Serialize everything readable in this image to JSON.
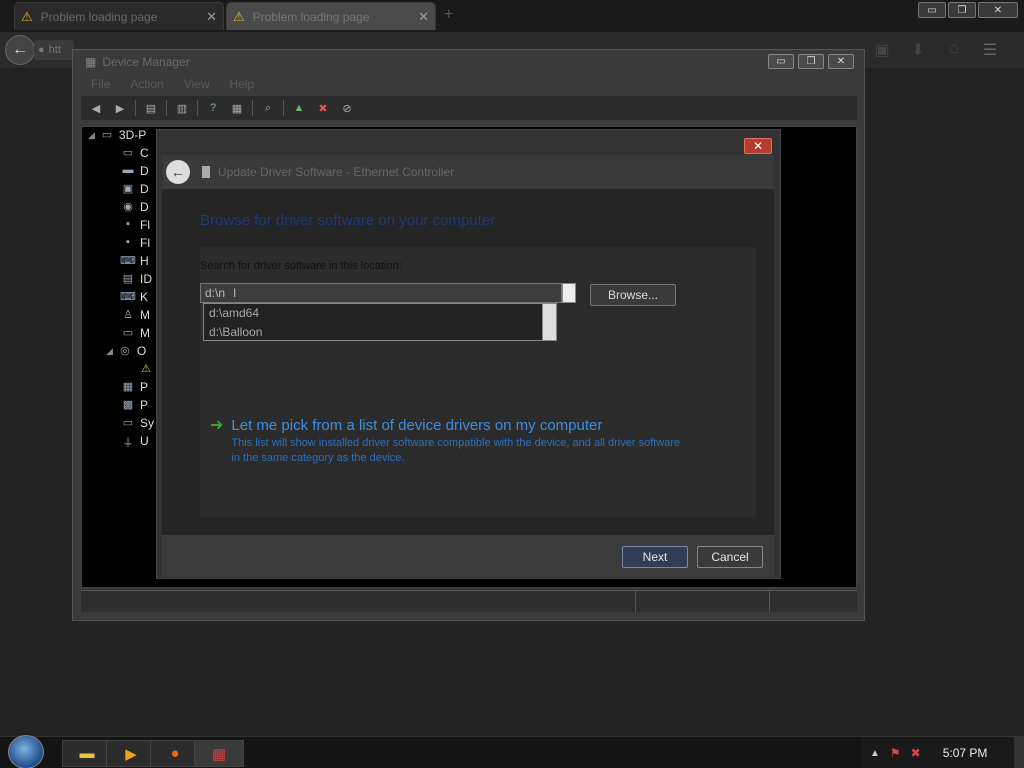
{
  "browser": {
    "tabs": [
      {
        "title": "Problem loading page",
        "icon": "warning-icon"
      },
      {
        "title": "Problem loading page",
        "icon": "warning-icon"
      }
    ],
    "new_tab": "+",
    "url_fragment": "htt",
    "win_buttons": {
      "minimize": "▭",
      "restore": "❐",
      "close": "✕"
    },
    "nav_icons": [
      "library-icon",
      "download-icon",
      "home-icon",
      "menu-icon"
    ]
  },
  "device_manager": {
    "title": "Device Manager",
    "menu": [
      "File",
      "Action",
      "View",
      "Help"
    ],
    "tree": [
      {
        "label": "3D-P",
        "icon": "computer-icon"
      },
      {
        "label": "C",
        "icon": "monitor-icon"
      },
      {
        "label": "D",
        "icon": "disk-icon"
      },
      {
        "label": "D",
        "icon": "display-icon"
      },
      {
        "label": "D",
        "icon": "dvd-icon"
      },
      {
        "label": "Fl",
        "icon": "floppy-icon"
      },
      {
        "label": "Fl",
        "icon": "floppy-drive-icon"
      },
      {
        "label": "H",
        "icon": "hid-icon"
      },
      {
        "label": "ID",
        "icon": "ide-icon"
      },
      {
        "label": "K",
        "icon": "keyboard-icon"
      },
      {
        "label": "M",
        "icon": "mouse-icon"
      },
      {
        "label": "M",
        "icon": "monitor-icon"
      },
      {
        "label": "O",
        "icon": "other-devices-icon"
      },
      {
        "label": "",
        "icon": "unknown-device-icon"
      },
      {
        "label": "P",
        "icon": "port-icon"
      },
      {
        "label": "P",
        "icon": "processor-icon"
      },
      {
        "label": "Sy",
        "icon": "system-icon"
      },
      {
        "label": "U",
        "icon": "usb-icon"
      }
    ]
  },
  "dialog": {
    "title": "Update Driver Software - Ethernet Controller",
    "close": "✕",
    "heading": "Browse for driver software on your computer",
    "search_label": "Search for driver software in this location:",
    "path_value": "d:\\n",
    "browse": "Browse...",
    "suggestions": [
      "d:\\amd64",
      "d:\\Balloon"
    ],
    "pick_title": "Let me pick from a list of device drivers on my computer",
    "pick_desc": "This list will show installed driver software compatible with the device, and all driver software in the same category as the device.",
    "next": "Next",
    "cancel": "Cancel"
  },
  "taskbar": {
    "items": [
      "explorer-icon",
      "media-player-icon",
      "firefox-icon",
      "device-manager-icon"
    ],
    "clock": "5:07 PM"
  }
}
